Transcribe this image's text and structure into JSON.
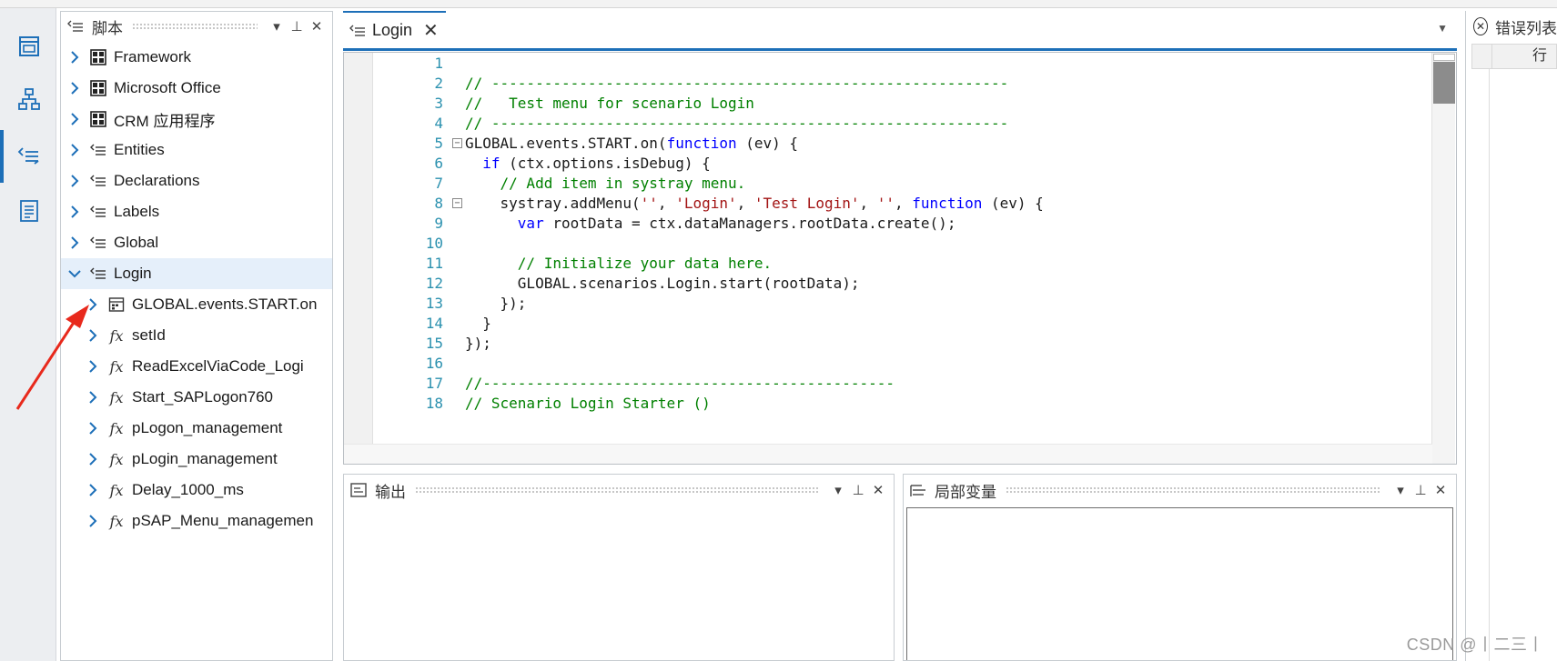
{
  "script_panel": {
    "title": "脚本",
    "items": [
      {
        "label": "Framework",
        "icon": "grid-icon",
        "level": 0,
        "expanded": false,
        "selected": false
      },
      {
        "label": "Microsoft Office",
        "icon": "grid-icon",
        "level": 0,
        "expanded": false,
        "selected": false
      },
      {
        "label": "CRM 应用程序",
        "icon": "grid-icon",
        "level": 0,
        "expanded": false,
        "selected": false
      },
      {
        "label": "Entities",
        "icon": "script-icon",
        "level": 0,
        "expanded": false,
        "selected": false
      },
      {
        "label": "Declarations",
        "icon": "script-icon",
        "level": 0,
        "expanded": false,
        "selected": false
      },
      {
        "label": "Labels",
        "icon": "script-icon",
        "level": 0,
        "expanded": false,
        "selected": false
      },
      {
        "label": "Global",
        "icon": "script-icon",
        "level": 0,
        "expanded": false,
        "selected": false
      },
      {
        "label": "Login",
        "icon": "script-icon",
        "level": 0,
        "expanded": true,
        "selected": true
      },
      {
        "label": "GLOBAL.events.START.on",
        "icon": "event-icon",
        "level": 1,
        "expanded": false,
        "selected": false
      },
      {
        "label": "setId",
        "icon": "function-icon",
        "level": 1,
        "expanded": false,
        "selected": false
      },
      {
        "label": "ReadExcelViaCode_Logi",
        "icon": "function-icon",
        "level": 1,
        "expanded": false,
        "selected": false
      },
      {
        "label": "Start_SAPLogon760",
        "icon": "function-icon",
        "level": 1,
        "expanded": false,
        "selected": false
      },
      {
        "label": "pLogon_management",
        "icon": "function-icon",
        "level": 1,
        "expanded": false,
        "selected": false
      },
      {
        "label": "pLogin_management",
        "icon": "function-icon",
        "level": 1,
        "expanded": false,
        "selected": false
      },
      {
        "label": "Delay_1000_ms",
        "icon": "function-icon",
        "level": 1,
        "expanded": false,
        "selected": false
      },
      {
        "label": "pSAP_Menu_managemen",
        "icon": "function-icon",
        "level": 1,
        "expanded": false,
        "selected": false
      }
    ]
  },
  "editor": {
    "tab_label": "Login",
    "lines": [
      {
        "n": "1",
        "fold": "",
        "tokens": []
      },
      {
        "n": "2",
        "fold": "",
        "tokens": [
          {
            "t": "// -----------------------------------------------------------",
            "c": "com"
          }
        ]
      },
      {
        "n": "3",
        "fold": "",
        "tokens": [
          {
            "t": "//   Test menu for scenario Login",
            "c": "com"
          }
        ]
      },
      {
        "n": "4",
        "fold": "",
        "tokens": [
          {
            "t": "// -----------------------------------------------------------",
            "c": "com"
          }
        ]
      },
      {
        "n": "5",
        "fold": "⊟",
        "tokens": [
          {
            "t": "GLOBAL.events.START.on(",
            "c": ""
          },
          {
            "t": "function",
            "c": "kw"
          },
          {
            "t": " (ev) {",
            "c": ""
          }
        ]
      },
      {
        "n": "6",
        "fold": "",
        "tokens": [
          {
            "t": "  ",
            "c": ""
          },
          {
            "t": "if",
            "c": "kw"
          },
          {
            "t": " (ctx.options.isDebug) {",
            "c": ""
          }
        ]
      },
      {
        "n": "7",
        "fold": "",
        "tokens": [
          {
            "t": "    ",
            "c": ""
          },
          {
            "t": "// Add item in systray menu.",
            "c": "com"
          }
        ]
      },
      {
        "n": "8",
        "fold": "⊟",
        "tokens": [
          {
            "t": "    systray.addMenu(",
            "c": ""
          },
          {
            "t": "''",
            "c": "str"
          },
          {
            "t": ", ",
            "c": ""
          },
          {
            "t": "'Login'",
            "c": "str"
          },
          {
            "t": ", ",
            "c": ""
          },
          {
            "t": "'Test Login'",
            "c": "str"
          },
          {
            "t": ", ",
            "c": ""
          },
          {
            "t": "''",
            "c": "str"
          },
          {
            "t": ", ",
            "c": ""
          },
          {
            "t": "function",
            "c": "kw"
          },
          {
            "t": " (ev) {",
            "c": ""
          }
        ]
      },
      {
        "n": "9",
        "fold": "",
        "tokens": [
          {
            "t": "      ",
            "c": ""
          },
          {
            "t": "var",
            "c": "kw"
          },
          {
            "t": " rootData = ctx.dataManagers.rootData.create();",
            "c": ""
          }
        ]
      },
      {
        "n": "10",
        "fold": "",
        "tokens": []
      },
      {
        "n": "11",
        "fold": "",
        "tokens": [
          {
            "t": "      ",
            "c": ""
          },
          {
            "t": "// Initialize your data here.",
            "c": "com"
          }
        ]
      },
      {
        "n": "12",
        "fold": "",
        "tokens": [
          {
            "t": "      GLOBAL.scenarios.Login.start(rootData);",
            "c": ""
          }
        ]
      },
      {
        "n": "13",
        "fold": "",
        "tokens": [
          {
            "t": "    });",
            "c": ""
          }
        ]
      },
      {
        "n": "14",
        "fold": "",
        "tokens": [
          {
            "t": "  }",
            "c": ""
          }
        ]
      },
      {
        "n": "15",
        "fold": "",
        "tokens": [
          {
            "t": "});",
            "c": ""
          }
        ]
      },
      {
        "n": "16",
        "fold": "",
        "tokens": []
      },
      {
        "n": "17",
        "fold": "",
        "tokens": [
          {
            "t": "//-----------------------------------------------",
            "c": "com"
          }
        ]
      },
      {
        "n": "18",
        "fold": "",
        "tokens": [
          {
            "t": "// Scenario Login Starter ()",
            "c": "com"
          }
        ]
      }
    ]
  },
  "output_panel": {
    "title": "输出"
  },
  "locals_panel": {
    "title": "局部变量"
  },
  "error_panel": {
    "title": "错误列表",
    "column_line": "行"
  },
  "watermark": "CSDN @丨二三丨",
  "colors": {
    "accent": "#1d6fb8",
    "comment": "#008000",
    "keyword": "#0000ff",
    "string": "#a31515",
    "arrow": "#e8291c"
  }
}
